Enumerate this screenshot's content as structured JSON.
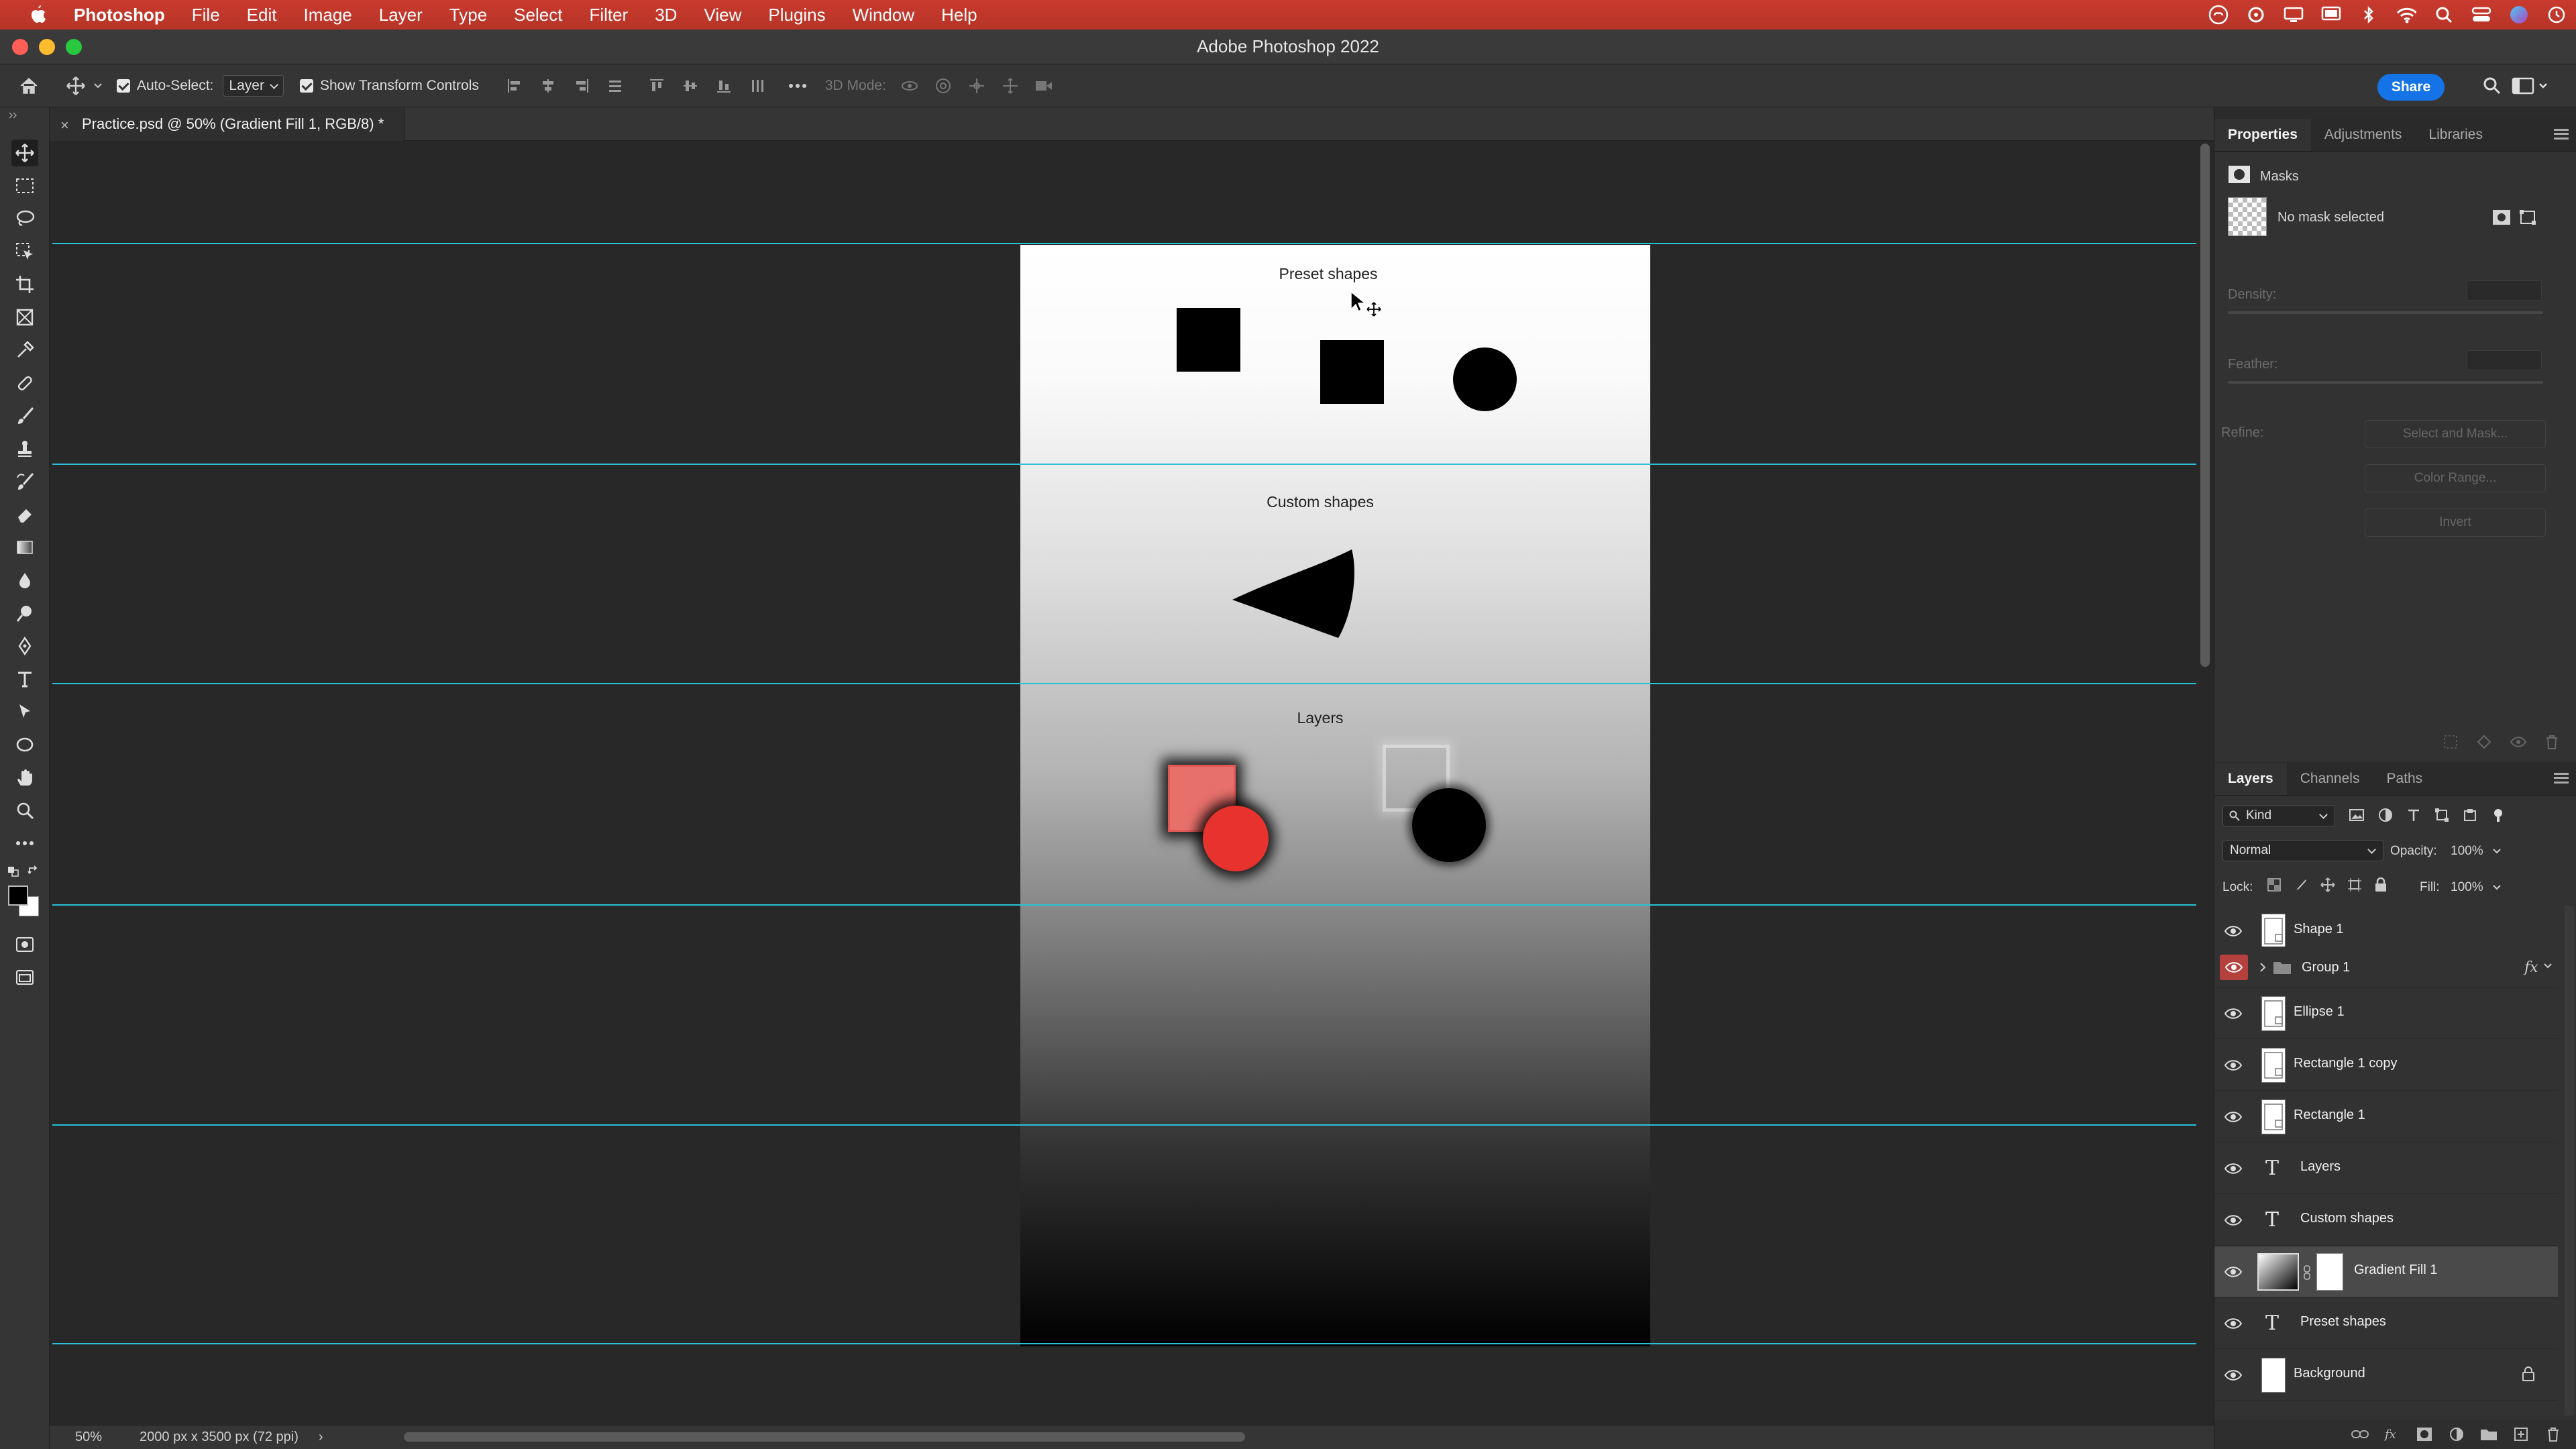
{
  "menubar": {
    "app": "Photoshop",
    "items": [
      "File",
      "Edit",
      "Image",
      "Layer",
      "Type",
      "Select",
      "Filter",
      "3D",
      "View",
      "Plugins",
      "Window",
      "Help"
    ],
    "tray_icons": [
      "creative-cloud-icon",
      "sync-icon",
      "display-icon",
      "cast-icon",
      "bluetooth-icon",
      "wifi-icon",
      "spotlight-icon",
      "control-center-icon",
      "siri-icon",
      "clock-icon"
    ]
  },
  "window": {
    "title": "Adobe Photoshop 2022"
  },
  "options": {
    "auto_select_label": "Auto-Select:",
    "auto_select_value": "Layer",
    "transform_label": "Show Transform Controls",
    "mode_3d": "3D Mode:",
    "share_label": "Share"
  },
  "document": {
    "tab_title": "Practice.psd @ 50% (Gradient Fill 1, RGB/8) *",
    "close_glyph": "×",
    "zoom": "50%",
    "size_info": "2000 px x 3500 px (72 ppi)",
    "status_arrow": "›"
  },
  "artboard": {
    "sections": {
      "preset": "Preset shapes",
      "custom": "Custom shapes",
      "layers": "Layers"
    },
    "colors": {
      "black": "#000000",
      "salmon": "#e8706b",
      "red": "#e8322d",
      "guide": "#27c2d8"
    }
  },
  "properties": {
    "tabs": [
      "Properties",
      "Adjustments",
      "Libraries"
    ],
    "section": "Masks",
    "mask_status": "No mask selected",
    "density_label": "Density:",
    "feather_label": "Feather:",
    "refine_label": "Refine:",
    "buttons": [
      "Select and Mask...",
      "Color Range...",
      "Invert"
    ]
  },
  "layers_panel": {
    "tabs": [
      "Layers",
      "Channels",
      "Paths"
    ],
    "filter_kind": "Kind",
    "blend_mode": "Normal",
    "opacity_label": "Opacity:",
    "opacity_value": "100%",
    "lock_label": "Lock:",
    "fill_label": "Fill:",
    "fill_value": "100%",
    "fx_glyph": "fx",
    "layers": [
      {
        "name": "Shape 1",
        "kind": "shape"
      },
      {
        "name": "Group 1",
        "kind": "group"
      },
      {
        "name": "Ellipse 1",
        "kind": "shape"
      },
      {
        "name": "Rectangle 1 copy",
        "kind": "shape"
      },
      {
        "name": "Rectangle 1",
        "kind": "shape"
      },
      {
        "name": "Layers",
        "kind": "text"
      },
      {
        "name": "Custom shapes",
        "kind": "text"
      },
      {
        "name": "Gradient Fill 1",
        "kind": "gradient"
      },
      {
        "name": "Preset shapes",
        "kind": "text"
      },
      {
        "name": "Background",
        "kind": "background"
      }
    ],
    "text_glyph": "T"
  }
}
